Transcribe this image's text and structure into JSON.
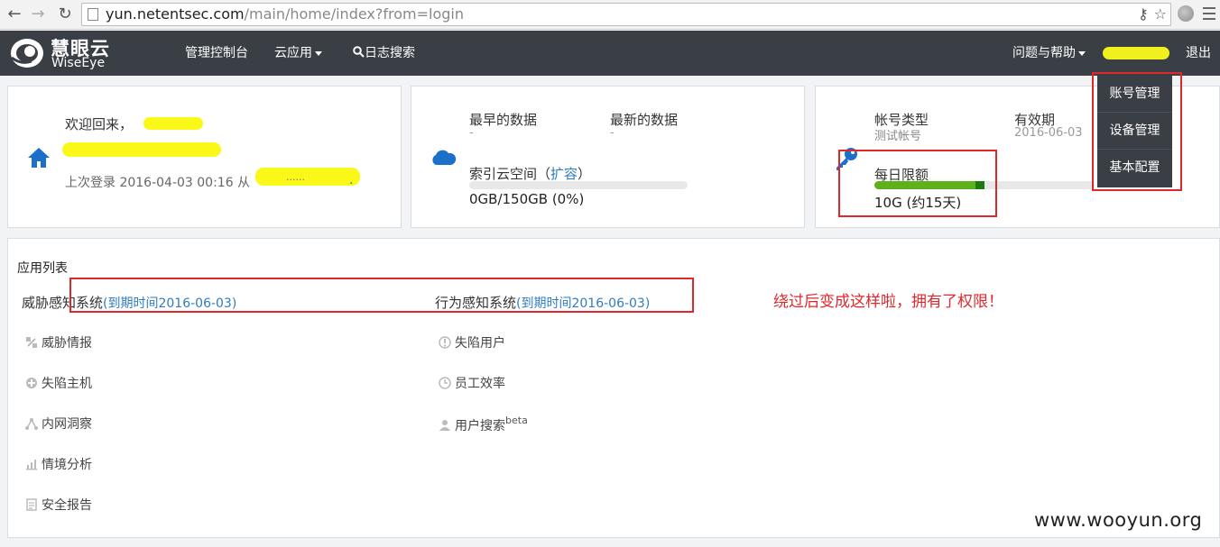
{
  "browser": {
    "url_host": "yun.netentsec.com",
    "url_path": "/main/home/index?from=login"
  },
  "header": {
    "logo_cn": "慧眼云",
    "logo_en": "WiseEye",
    "nav": [
      "管理控制台",
      "云应用",
      "日志搜索"
    ],
    "help_label": "问题与帮助",
    "logout_label": "退出"
  },
  "dropdown": {
    "items": [
      "账号管理",
      "设备管理",
      "基本配置"
    ]
  },
  "welcome_card": {
    "greeting": "欢迎回来，",
    "last_login_label": "上次登录",
    "last_login_time": "2016-04-03 00:16",
    "from_label": "从",
    "ip_masked": "......",
    "ip_suffix": "."
  },
  "data_card": {
    "earliest_label": "最早的数据",
    "earliest_value": "-",
    "latest_label": "最新的数据",
    "latest_value": "-",
    "index_space_label": "索引云空间",
    "expand_link": "扩容",
    "paren_open": "（",
    "paren_close": "）",
    "usage_text": "0GB/150GB (0%)",
    "usage_fraction": 0.0
  },
  "account_card": {
    "type_label": "帐号类型",
    "type_value": "测试帐号",
    "validity_label": "有效期",
    "validity_value": "2016-06-03",
    "daily_limit_label": "每日限额",
    "daily_limit_value": "10G (约15天)",
    "daily_limit_fraction": 0.5
  },
  "app_list": {
    "title": "应用列表",
    "groups": [
      {
        "name": "威胁感知系统",
        "expire": "(到期时间2016-06-03)",
        "items": [
          "威胁情报",
          "失陷主机",
          "内网洞察",
          "情境分析",
          "安全报告"
        ]
      },
      {
        "name": "行为感知系统",
        "expire": "(到期时间2016-06-03)",
        "items": [
          "失陷用户",
          "员工效率",
          "用户搜索"
        ],
        "beta_label": "beta"
      }
    ]
  },
  "annotation": "绕过后变成这样啦，拥有了权限！",
  "watermark": "www.wooyun.org",
  "colors": {
    "header_bg": "#3a3e45",
    "accent_blue": "#2e7cc3",
    "progress_green": "#5fb11b",
    "annotation_red": "#e0282c",
    "highlight_yellow": "#f9f818"
  }
}
